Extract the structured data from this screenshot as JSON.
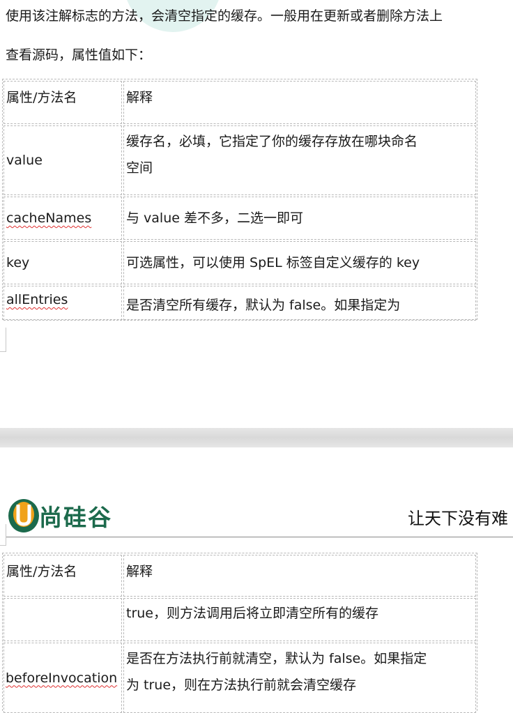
{
  "intro": {
    "line1": "使用该注解标志的方法，会清空指定的缓存。一般用在更新或者删除方法上",
    "line2": "查看源码，属性值如下："
  },
  "table1": {
    "header": [
      "属性/方法名",
      "解释"
    ],
    "rows": [
      [
        "value",
        "缓存名，必填，它指定了你的缓存存放在哪块命名",
        "空间"
      ],
      [
        "cacheNames",
        "与 value 差不多，二选一即可"
      ],
      [
        "key",
        "可选属性，可以使用 SpEL 标签自定义缓存的 key"
      ],
      [
        "allEntries",
        "是否清空所有缓存，默认为 false。如果指定为"
      ]
    ]
  },
  "page_header": {
    "logo_text": "尚硅谷",
    "slogan": "让天下没有难"
  },
  "table2": {
    "header": [
      "属性/方法名",
      "解释"
    ],
    "rows": [
      [
        "",
        "true，则方法调用后将立即清空所有的缓存"
      ],
      [
        "beforeInvocation",
        "是否在方法执行前就清空，默认为 false。如果指定",
        "为 true，则在方法执行前就会清空缓存"
      ]
    ]
  },
  "colors": {
    "logo_green": "#1c6a4c",
    "logo_orange": "#f0a21a",
    "spell_underline": "#e03030"
  }
}
